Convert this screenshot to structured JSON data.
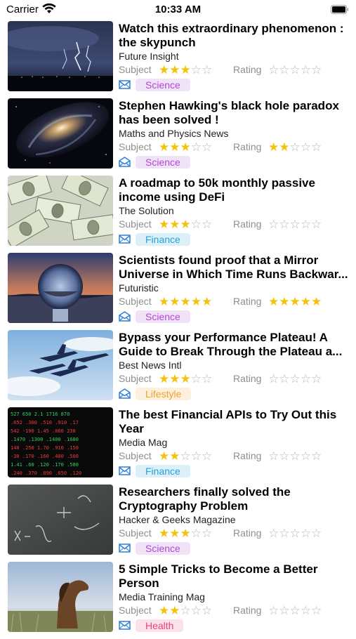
{
  "status_bar": {
    "carrier": "Carrier",
    "time": "10:33 AM"
  },
  "labels": {
    "subject": "Subject",
    "rating": "Rating"
  },
  "colors": {
    "star_filled": "#f4c20d",
    "star_empty": "#b8b8b8",
    "mail_icon": "#2f7fd6"
  },
  "articles": [
    {
      "title": "Watch this extraordinary phenomenon : the skypunch",
      "source": "Future Insight",
      "subject_stars": 3,
      "rating_stars": 0,
      "category": "Science",
      "category_color": "#b148d2",
      "category_bg": "#f1e3f7",
      "image": "lightning storm over city at night",
      "mail_icon": "mail-closed"
    },
    {
      "title": "Stephen Hawking's black hole paradox has been solved !",
      "source": "Maths and Physics News",
      "subject_stars": 3,
      "rating_stars": 2,
      "category": "Science",
      "category_color": "#b148d2",
      "category_bg": "#f1e3f7",
      "image": "spiral galaxy",
      "mail_icon": "mail-open"
    },
    {
      "title": "A roadmap to 50k monthly passive income using DeFi",
      "source": "The Solution",
      "subject_stars": 3,
      "rating_stars": 0,
      "category": "Finance",
      "category_color": "#2a9fd8",
      "category_bg": "#dcf0fa",
      "image": "pile of dollar bills",
      "mail_icon": "mail-closed"
    },
    {
      "title": "Scientists found proof that a Mirror Universe in Which Time Runs Backwar...",
      "source": "Futuristic",
      "subject_stars": 5,
      "rating_stars": 5,
      "category": "Science",
      "category_color": "#b148d2",
      "category_bg": "#f1e3f7",
      "image": "crystal ball at sunset",
      "mail_icon": "mail-open"
    },
    {
      "title": "Bypass your Performance Plateau! A Guide to Break Through the Plateau a...",
      "source": "Best News Intl",
      "subject_stars": 3,
      "rating_stars": 0,
      "category": "Lifestyle",
      "category_color": "#f0a030",
      "category_bg": "#fdf0dc",
      "image": "jets flying in formation",
      "mail_icon": "mail-open"
    },
    {
      "title": "The best Financial APIs to Try Out this Year",
      "source": "Media Mag",
      "subject_stars": 2,
      "rating_stars": 0,
      "category": "Finance",
      "category_color": "#2a9fd8",
      "category_bg": "#dcf0fa",
      "image": "stock market ticker board",
      "mail_icon": "mail-closed"
    },
    {
      "title": "Researchers finally solved the Cryptography Problem",
      "source": "Hacker & Geeks Magazine",
      "subject_stars": 3,
      "rating_stars": 0,
      "category": "Science",
      "category_color": "#b148d2",
      "category_bg": "#f1e3f7",
      "image": "math formulas on chalkboard",
      "mail_icon": "mail-closed"
    },
    {
      "title": "5 Simple Tricks to Become a Better Person",
      "source": "Media Training Mag",
      "subject_stars": 2,
      "rating_stars": 0,
      "category": "Health",
      "category_color": "#e8457a",
      "category_bg": "#fbe2ea",
      "image": "wild horse in grass",
      "mail_icon": "mail-closed"
    }
  ]
}
